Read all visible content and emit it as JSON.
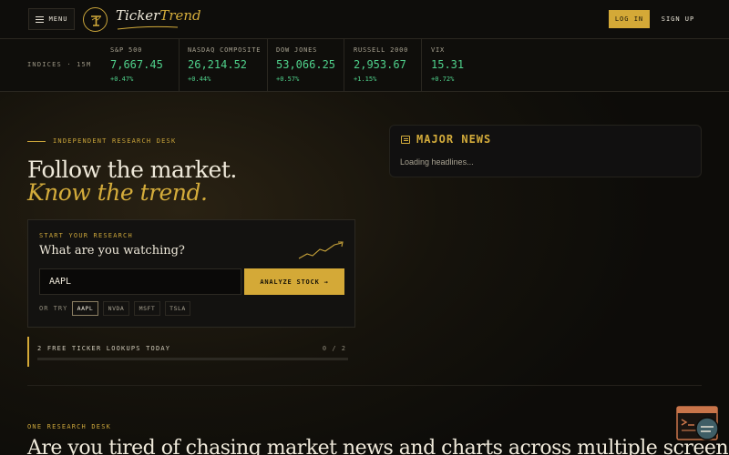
{
  "header": {
    "menu_label": "MENU",
    "logo_text_a": "Ticker",
    "logo_text_b": "Trend",
    "login_label": "LOG IN",
    "signup_label": "SIGN UP"
  },
  "ticker_bar": {
    "label": "INDICES · 15M",
    "items": [
      {
        "name": "S&P 500",
        "price": "7,667.45",
        "change": "+0.47%"
      },
      {
        "name": "NASDAQ COMPOSITE",
        "price": "26,214.52",
        "change": "+0.44%"
      },
      {
        "name": "DOW JONES",
        "price": "53,066.25",
        "change": "+0.57%"
      },
      {
        "name": "RUSSELL 2000",
        "price": "2,953.67",
        "change": "+1.15%"
      },
      {
        "name": "VIX",
        "price": "15.31",
        "change": "+0.72%"
      }
    ]
  },
  "hero": {
    "kicker": "INDEPENDENT RESEARCH DESK",
    "line1": "Follow the market.",
    "line2": "Know the trend."
  },
  "research": {
    "kicker": "START YOUR RESEARCH",
    "title": "What are you watching?",
    "input_value": "AAPL",
    "analyze_label": "ANALYZE STOCK",
    "analyze_arrow": "→",
    "or_try": "OR TRY",
    "chips": [
      "AAPL",
      "NVDA",
      "MSFT",
      "TSLA"
    ]
  },
  "lookups": {
    "label": "2 FREE TICKER LOOKUPS TODAY",
    "count": "0 / 2",
    "used_fraction": 0
  },
  "news": {
    "title": "MAJOR NEWS",
    "loading": "Loading headlines..."
  },
  "bottom": {
    "kicker": "ONE RESEARCH DESK",
    "headline": "Are you tired of chasing market news and charts across multiple screens"
  },
  "colors": {
    "accent": "#d4a937",
    "positive": "#4fd18b",
    "background": "#0b0a08"
  }
}
